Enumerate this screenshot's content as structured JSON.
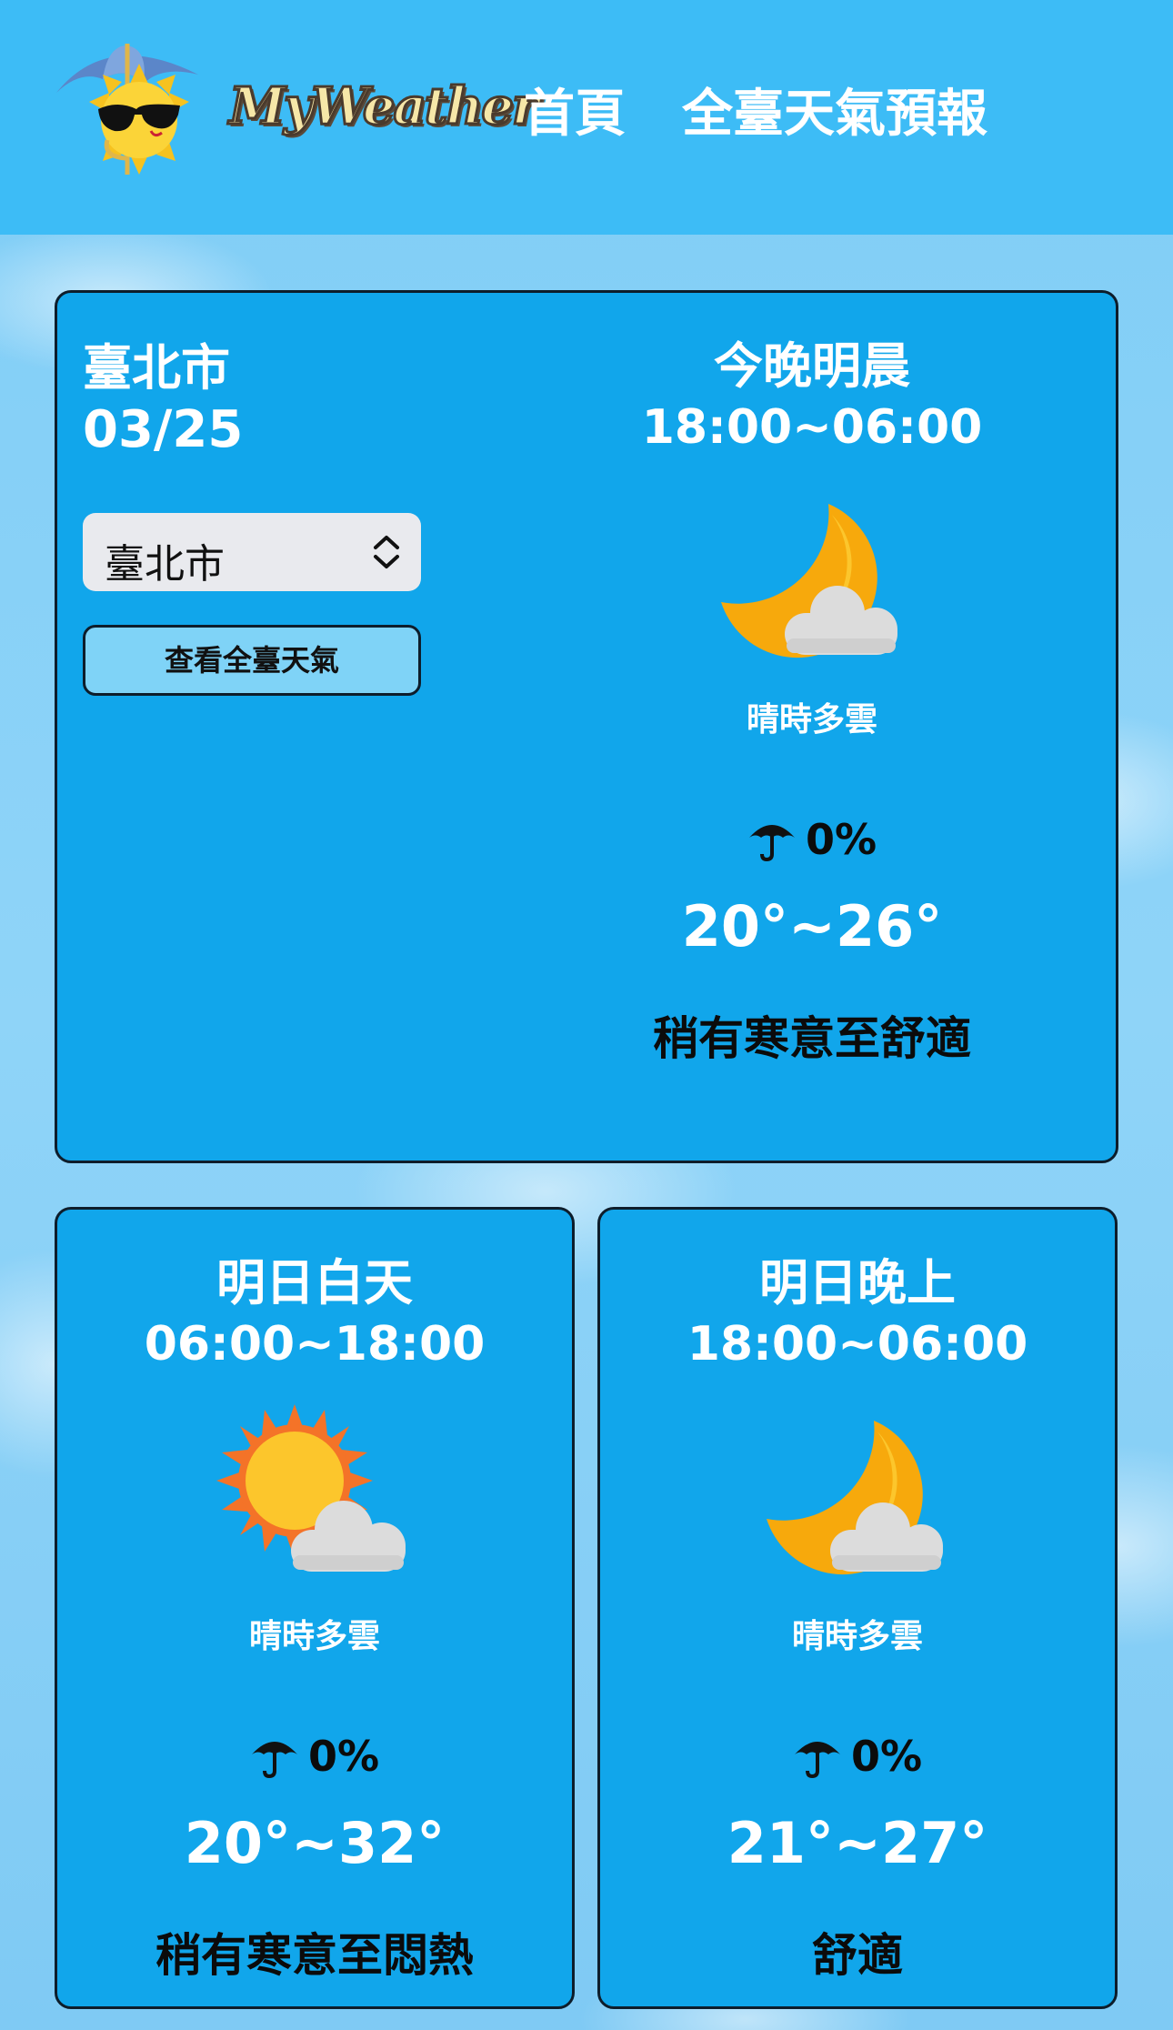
{
  "header": {
    "logo_text": "MyWeather",
    "nav": [
      "首頁",
      "全臺天氣預報"
    ]
  },
  "location": {
    "city": "臺北市",
    "date": "03/25",
    "select_value": "臺北市",
    "view_all_label": "查看全臺天氣"
  },
  "forecasts": [
    {
      "period": "今晚明晨",
      "time": "18:00~06:00",
      "icon": "moon-cloud-icon",
      "desc": "晴時多雲",
      "rain": "0%",
      "temp": "20°~26°",
      "comfort": "稍有寒意至舒適"
    },
    {
      "period": "明日白天",
      "time": "06:00~18:00",
      "icon": "sun-cloud-icon",
      "desc": "晴時多雲",
      "rain": "0%",
      "temp": "20°~32°",
      "comfort": "稍有寒意至悶熱"
    },
    {
      "period": "明日晚上",
      "time": "18:00~06:00",
      "icon": "moon-cloud-icon",
      "desc": "晴時多雲",
      "rain": "0%",
      "temp": "21°~27°",
      "comfort": "舒適"
    }
  ],
  "colors": {
    "header_bg": "#3dbcf6",
    "card_bg": "#11a6eb",
    "card_border": "#0d1d2b",
    "moon": "#f7a90c",
    "sun": "#fcc62c",
    "sun_rays": "#f47328",
    "cloud": "#dcdcdc"
  }
}
